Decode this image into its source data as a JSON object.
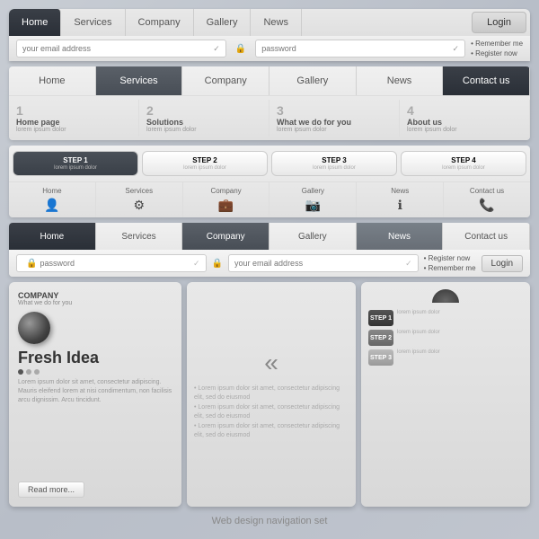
{
  "nav1": {
    "tabs": [
      "Home",
      "Services",
      "Company",
      "Gallery",
      "News"
    ],
    "active": "Home",
    "login": "Login",
    "email_placeholder": "your email address",
    "password_placeholder": "password",
    "remember": "Remember me",
    "register": "Register now"
  },
  "nav2": {
    "tabs": [
      "Home",
      "Services",
      "Company",
      "Gallery",
      "News",
      "Contact us"
    ],
    "active": "Services",
    "dark": "Contact us",
    "subitems": [
      {
        "num": "1",
        "title": "Home page",
        "desc": "lorem ipsum dolor"
      },
      {
        "num": "2",
        "title": "Solutions",
        "desc": "lorem ipsum dolor"
      },
      {
        "num": "3",
        "title": "What we do for you",
        "desc": "lorem ipsum dolor"
      },
      {
        "num": "4",
        "title": "About us",
        "desc": "lorem ipsum dolor"
      }
    ]
  },
  "nav3": {
    "steps": [
      {
        "label": "STEP 1",
        "desc": "lorem ipsum dolor",
        "active": true
      },
      {
        "label": "STEP 2",
        "desc": "lorem ipsum dolor",
        "active": false
      },
      {
        "label": "STEP 3",
        "desc": "lorem ipsum dolor",
        "active": false
      },
      {
        "label": "STEP 4",
        "desc": "lorem ipsum dolor",
        "active": false
      }
    ],
    "icons": [
      {
        "label": "Home",
        "icon": "🏠"
      },
      {
        "label": "Services",
        "icon": "⚙"
      },
      {
        "label": "Company",
        "icon": "💼"
      },
      {
        "label": "Gallery",
        "icon": "📷"
      },
      {
        "label": "News",
        "icon": "ℹ"
      },
      {
        "label": "Contact us",
        "icon": "📞"
      }
    ]
  },
  "nav4": {
    "tabs": [
      "Home",
      "Services",
      "Company",
      "Gallery",
      "News",
      "Contact us"
    ],
    "active": "Home",
    "mid": "Company",
    "gray": "News",
    "password_placeholder": "password",
    "email_placeholder": "your email address",
    "register": "Register now",
    "remember": "Remember me",
    "login": "Login"
  },
  "card1": {
    "company": "COMPANY",
    "whatwedo": "What we do for you",
    "title": "Fresh Idea",
    "body": "Lorem ipsum dolor sit amet, consectetur adipiscing. Mauris eleifend lorem at nisi condimentum, non facilisis arcu dignissim. Arcu tincidunt.",
    "read_more": "Read more..."
  },
  "card2": {
    "bullets": [
      "Lorem ipsum dolor sit amet, consectetur adipiscing elit, sed do eiusmod",
      "Lorem ipsum dolor sit amet, consectetur adipiscing elit, sed do eiusmod",
      "Lorem ipsum dolor sit amet, consectetur adipiscing elit, sed do eiusmod"
    ]
  },
  "card3": {
    "steps": [
      {
        "label": "STEP 1",
        "desc": "lorem ipsum dolor"
      },
      {
        "label": "STEP 2",
        "desc": "lorem ipsum dolor"
      },
      {
        "label": "STEP 3",
        "desc": "lorem ipsum dolor"
      }
    ]
  },
  "footer": {
    "text": "Web design navigation set"
  }
}
